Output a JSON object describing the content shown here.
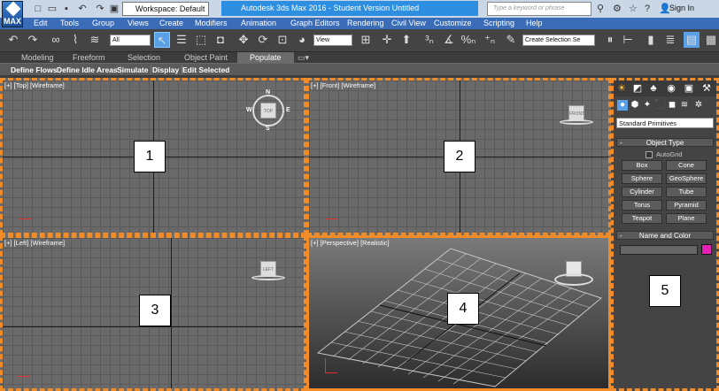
{
  "app": {
    "logo_label": "MAX",
    "workspace": "Workspace: Default",
    "title": "Autodesk 3ds Max 2016 - Student Version    Untitled",
    "search_placeholder": "Type a keyword or phrase",
    "sign_in": "Sign In"
  },
  "menu": [
    "Edit",
    "Tools",
    "Group",
    "Views",
    "Create",
    "Modifiers",
    "Animation",
    "Graph Editors",
    "Rendering",
    "Civil View",
    "Customize",
    "Scripting",
    "Help"
  ],
  "toolbar": {
    "filter_select": "All",
    "coord_select": "View",
    "selection_set": "Create Selection Se"
  },
  "ribbon_tabs": [
    "Modeling",
    "Freeform",
    "Selection",
    "Object Paint",
    "Populate"
  ],
  "ribbon_active": "Populate",
  "ribbon_buttons": [
    "Define Flows",
    "Define Idle Areas",
    "Simulate",
    "Display",
    "Edit Selected"
  ],
  "viewports": [
    {
      "label": "[+] [Top] [Wireframe]",
      "number": "1",
      "cube_label": "TOP"
    },
    {
      "label": "[+] [Front] [Wireframe]",
      "number": "2",
      "cube_label": "FRONT"
    },
    {
      "label": "[+] [Left] [Wireframe]",
      "number": "3",
      "cube_label": "LEFT"
    },
    {
      "label": "[+] [Perspective] [Realistic]",
      "number": "4",
      "cube_label": ""
    }
  ],
  "compass": {
    "n": "N",
    "s": "S",
    "e": "E",
    "w": "W"
  },
  "command_panel": {
    "number": "5",
    "category": "Standard Primitives",
    "object_type_title": "Object Type",
    "autogrid": "AutoGrid",
    "buttons": [
      "Box",
      "Cone",
      "Sphere",
      "GeoSphere",
      "Cylinder",
      "Tube",
      "Torus",
      "Pyramid",
      "Teapot",
      "Plane"
    ],
    "name_color_title": "Name and Color",
    "color": "#e620b6"
  }
}
